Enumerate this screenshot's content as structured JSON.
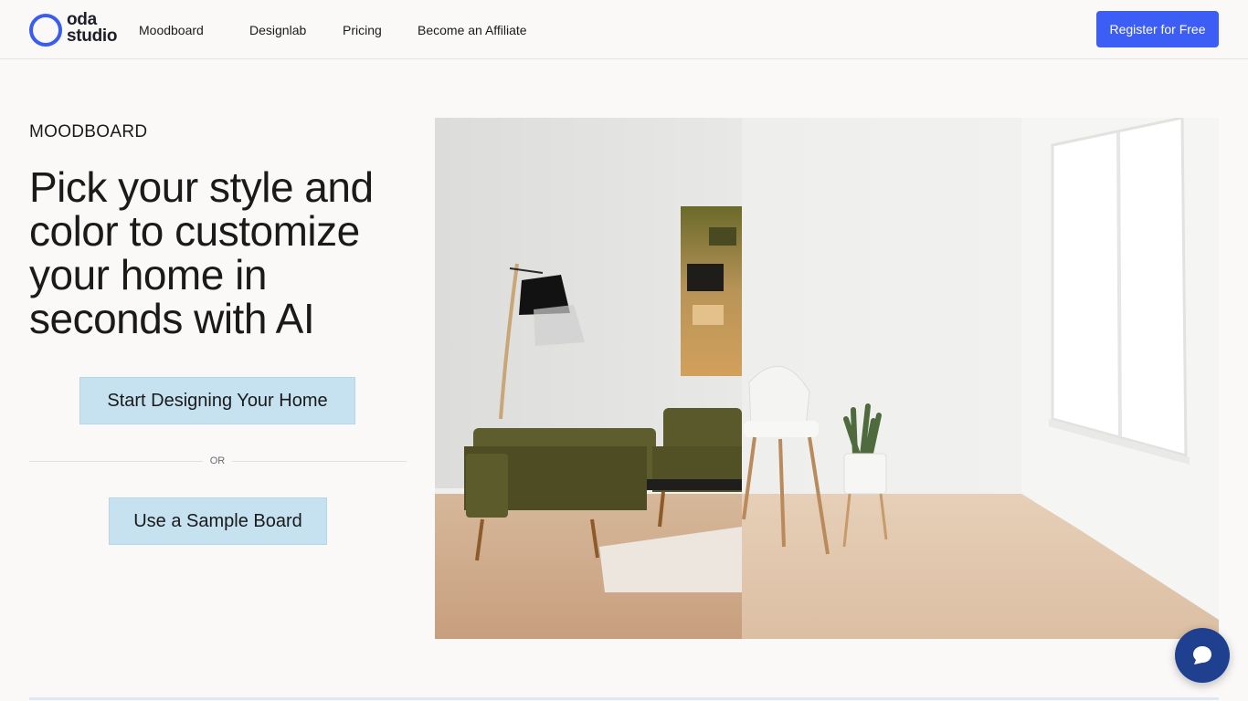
{
  "brand": {
    "line1": "oda",
    "line2": "studio",
    "accent": "#3a5cf0"
  },
  "nav": {
    "items": [
      {
        "label": "Moodboard"
      },
      {
        "label": "Designlab"
      },
      {
        "label": "Pricing"
      },
      {
        "label": "Become an Affiliate"
      }
    ],
    "register_label": "Register for Free",
    "register_color": "#3d5ef5"
  },
  "hero": {
    "eyebrow": "MOODBOARD",
    "title": "Pick your style and color to customize your home in seconds with AI",
    "primary_cta": "Start Designing Your Home",
    "divider_text": "OR",
    "secondary_cta": "Use a Sample Board",
    "cta_color": "#c6e1f0",
    "image_subject": "living room before/after: furnished side with green sofa, floor lamp, abstract painting; empty side with white chair, plant, window"
  },
  "chat": {
    "icon": "chat-bubble-icon",
    "color": "#1f3f8f"
  }
}
